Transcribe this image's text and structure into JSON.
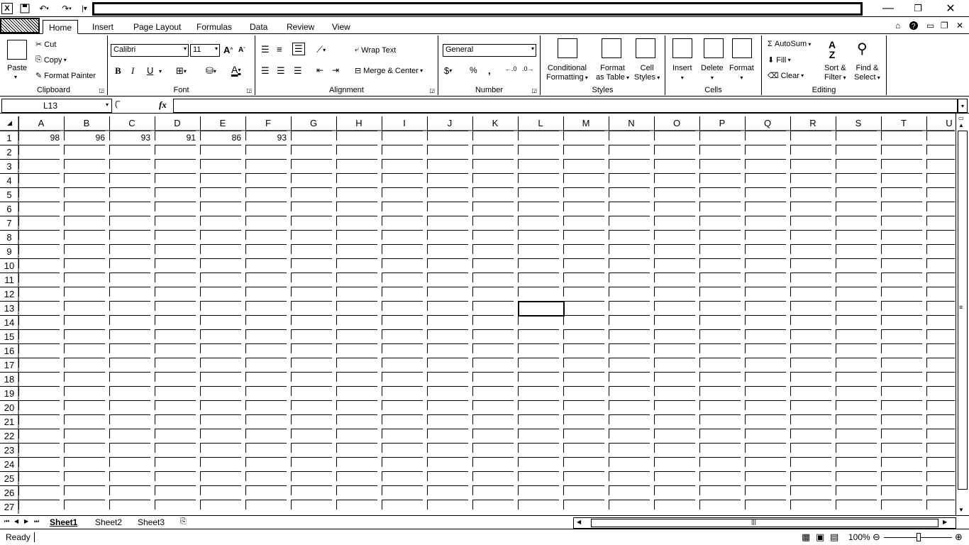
{
  "qat": {
    "app_icon": "X"
  },
  "window": {
    "minimize": "—",
    "restore": "❐",
    "close": "✕"
  },
  "tabs": [
    "Home",
    "Insert",
    "Page Layout",
    "Formulas",
    "Data",
    "Review",
    "View"
  ],
  "ribbon": {
    "clipboard": {
      "label": "Clipboard",
      "paste": "Paste",
      "cut": "Cut",
      "copy": "Copy",
      "format_painter": "Format Painter"
    },
    "font": {
      "label": "Font",
      "font_name": "Calibri",
      "font_size": "11",
      "bold": "B",
      "italic": "I",
      "underline": "U"
    },
    "alignment": {
      "label": "Alignment",
      "wrap_text": "Wrap Text",
      "merge_center": "Merge & Center"
    },
    "number": {
      "label": "Number",
      "format": "General",
      "percent": "%",
      "comma": ","
    },
    "styles": {
      "label": "Styles",
      "conditional_1": "Conditional",
      "conditional_2": "Formatting",
      "format_table_1": "Format",
      "format_table_2": "as Table",
      "cell_styles_1": "Cell",
      "cell_styles_2": "Styles"
    },
    "cells": {
      "label": "Cells",
      "insert": "Insert",
      "delete": "Delete",
      "format": "Format"
    },
    "editing": {
      "label": "Editing",
      "autosum": "AutoSum",
      "fill": "Fill",
      "clear": "Clear",
      "sort_1": "Sort &",
      "sort_2": "Filter",
      "find_1": "Find &",
      "find_2": "Select"
    }
  },
  "formula_bar": {
    "name_box": "L13",
    "fx": "fx",
    "formula": ""
  },
  "columns": [
    "A",
    "B",
    "C",
    "D",
    "E",
    "F",
    "G",
    "H",
    "I",
    "J",
    "K",
    "L",
    "M",
    "N",
    "O",
    "P",
    "Q",
    "R",
    "S",
    "T",
    "U"
  ],
  "rows": [
    "1",
    "2",
    "3",
    "4",
    "5",
    "6",
    "7",
    "8",
    "9",
    "10",
    "11",
    "12",
    "13",
    "14",
    "15",
    "16",
    "17",
    "18",
    "19",
    "20",
    "21",
    "22",
    "23",
    "24",
    "25",
    "26",
    "27"
  ],
  "cells": {
    "A1": "98",
    "B1": "96",
    "C1": "93",
    "D1": "91",
    "E1": "86",
    "F1": "93"
  },
  "sheets": [
    "Sheet1",
    "Sheet2",
    "Sheet3"
  ],
  "status": {
    "ready": "Ready",
    "zoom": "100%"
  }
}
